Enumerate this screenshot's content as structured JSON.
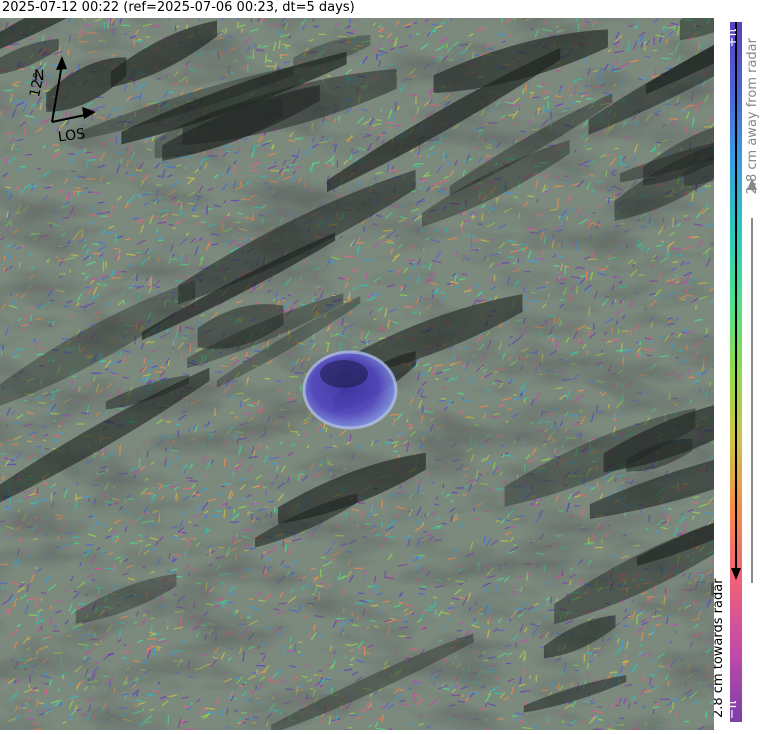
{
  "title": "2025-07-12 00:22 (ref=2025-07-06 00:23, dt=5 days)",
  "compass": {
    "north_label": "N",
    "heading_label": "12°",
    "los_label": "LOS"
  },
  "colorbar": {
    "max_label": "+π",
    "min_label": "−π",
    "away_label": "2.8 cm away from radar",
    "towards_label": "2.8 cm towards radar",
    "stops": [
      "#7b3fa6",
      "#c24aa8",
      "#f0607a",
      "#f58a4c",
      "#cfc247",
      "#92d94c",
      "#4fe08a",
      "#2bc9bd",
      "#3a9ee0",
      "#4a66d6",
      "#5a3fc2"
    ]
  },
  "palette": {
    "terrain_dark": "#1e2320",
    "terrain_mid": "#7c8a7e",
    "terrain_light": "#c9d0c6",
    "crater_fill": "#4a3fb5",
    "crater_rim": "#8fa2e0"
  }
}
